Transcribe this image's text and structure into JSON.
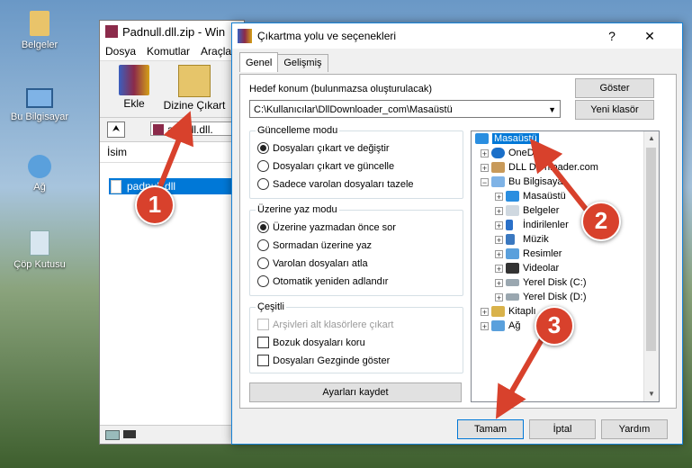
{
  "desktop": {
    "icons": [
      {
        "label": "Belgeler"
      },
      {
        "label": "Bu Bilgisayar"
      },
      {
        "label": "Ağ"
      },
      {
        "label": "Çöp Kutusu"
      }
    ]
  },
  "winrar": {
    "title": "Padnull.dll.zip - Win",
    "menu": [
      "Dosya",
      "Komutlar",
      "Araçla"
    ],
    "toolbar": {
      "add": "Ekle",
      "extract_to": "Dizine Çıkart"
    },
    "path": "adnull.dll.",
    "list_header": "İsim",
    "file": "padnull.dll"
  },
  "dialog": {
    "title": "Çıkartma yolu ve seçenekleri",
    "help_btn": "?",
    "close_btn": "✕",
    "tabs": [
      "Genel",
      "Gelişmiş"
    ],
    "target_label": "Hedef konum (bulunmazsa oluşturulacak)",
    "target_value": "C:\\Kullanıcılar\\DllDownloader_com\\Masaüstü",
    "show_btn": "Göster",
    "new_folder_btn": "Yeni klasör",
    "update_group": {
      "title": "Güncelleme modu",
      "options": [
        "Dosyaları çıkart ve değiştir",
        "Dosyaları çıkart ve güncelle",
        "Sadece varolan dosyaları tazele"
      ],
      "selected": 0
    },
    "overwrite_group": {
      "title": "Üzerine yaz modu",
      "options": [
        "Üzerine yazmadan önce sor",
        "Sormadan üzerine yaz",
        "Varolan dosyaları atla",
        "Otomatik yeniden adlandır"
      ],
      "selected": 0
    },
    "misc_group": {
      "title": "Çeşitli",
      "options": [
        "Arşivleri alt klasörlere çıkart",
        "Bozuk dosyaları koru",
        "Dosyaları Gezginde göster"
      ]
    },
    "save_settings_btn": "Ayarları kaydet",
    "tree": [
      {
        "label": "Masaüstü",
        "icon": "desktop-icon"
      },
      {
        "label": "OneD",
        "icon": "cloud-icon"
      },
      {
        "label": "DLL Do     nloader.com",
        "icon": "user-icon"
      },
      {
        "label": "Bu Bilgisaya",
        "icon": "computer-icon"
      },
      {
        "label": "Masaüstü",
        "icon": "desktop-icon"
      },
      {
        "label": "Belgeler",
        "icon": "documents-icon"
      },
      {
        "label": "İndirilenler",
        "icon": "download-icon"
      },
      {
        "label": "Müzik",
        "icon": "music-icon"
      },
      {
        "label": "Resimler",
        "icon": "pictures-icon"
      },
      {
        "label": "Videolar",
        "icon": "video-icon"
      },
      {
        "label": "Yerel Disk (C:)",
        "icon": "drive-icon"
      },
      {
        "label": "Yerel Disk (D:)",
        "icon": "drive-icon"
      },
      {
        "label": "Kitaplı",
        "icon": "library-icon"
      },
      {
        "label": "Ağ",
        "icon": "network-icon"
      }
    ],
    "ok_btn": "Tamam",
    "cancel_btn": "İptal",
    "help_text_btn": "Yardım"
  },
  "annotations": [
    "1",
    "2",
    "3"
  ],
  "colors": {
    "accent": "#0078d7",
    "badge": "#d8412c"
  }
}
